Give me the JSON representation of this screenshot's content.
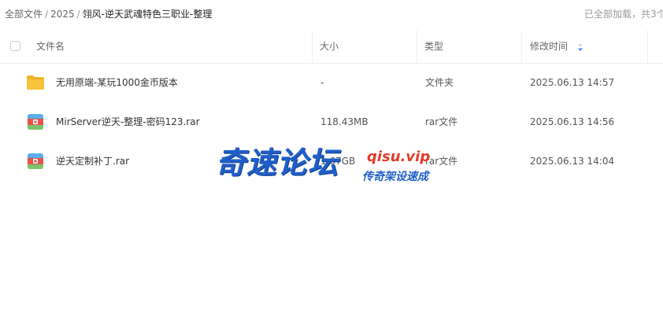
{
  "breadcrumb": {
    "root": "全部文件",
    "year": "2025",
    "current": "翎风-逆天武魂特色三职业-整理",
    "separator": "/"
  },
  "load_status": "已全部加载，共3个",
  "table": {
    "columns": {
      "name": "文件名",
      "size": "大小",
      "type": "类型",
      "modified": "修改时间"
    },
    "sort": {
      "column": "modified",
      "icon": "sort-icon"
    },
    "rows": [
      {
        "name": "无用原端-某玩1000金币版本",
        "size": "-",
        "type": "文件夹",
        "modified": "2025.06.13 14:57",
        "icon": "folder-icon"
      },
      {
        "name": "MirServer逆天-整理-密码123.rar",
        "size": "118.43MB",
        "type": "rar文件",
        "modified": "2025.06.13 14:56",
        "icon": "archive-icon"
      },
      {
        "name": "逆天定制补丁.rar",
        "size": "1.67GB",
        "type": "rar文件",
        "modified": "2025.06.13 14:04",
        "icon": "archive-icon"
      }
    ]
  },
  "watermark": {
    "name": "奇速论坛",
    "site": "qisu.vip",
    "slogan": "传奇架设速成"
  },
  "colors": {
    "folder": "#f7c33a",
    "archive_accent": "#e8524a",
    "watermark_blue": "#1f5fc9",
    "watermark_red": "#e23b2a",
    "sort_icon": "#3b8beb"
  }
}
